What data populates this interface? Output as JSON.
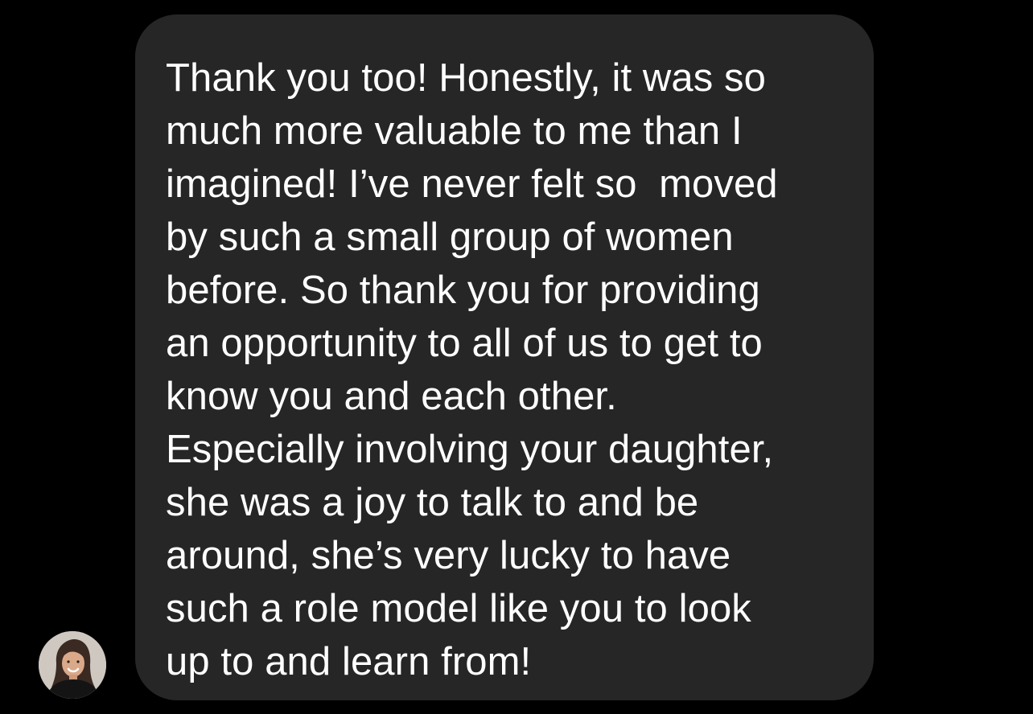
{
  "conversation": {
    "sender": {
      "avatar_icon": "profile-photo-icon"
    },
    "message": {
      "bubble_color": "#262626",
      "text_color": "#ffffff",
      "lines": [
        "Thank you too! Honestly, it was so",
        "much more valuable to me than I",
        "imagined! I’ve never felt so  moved",
        "by such a small group of women",
        "before. So thank you for providing",
        "an opportunity to all of us to get to",
        "know you and each other.",
        "Especially involving your daughter,",
        "she was a joy to talk to and be",
        "around, she’s very lucky to have",
        "such a role model like you to look",
        "up to and learn from!"
      ]
    }
  }
}
